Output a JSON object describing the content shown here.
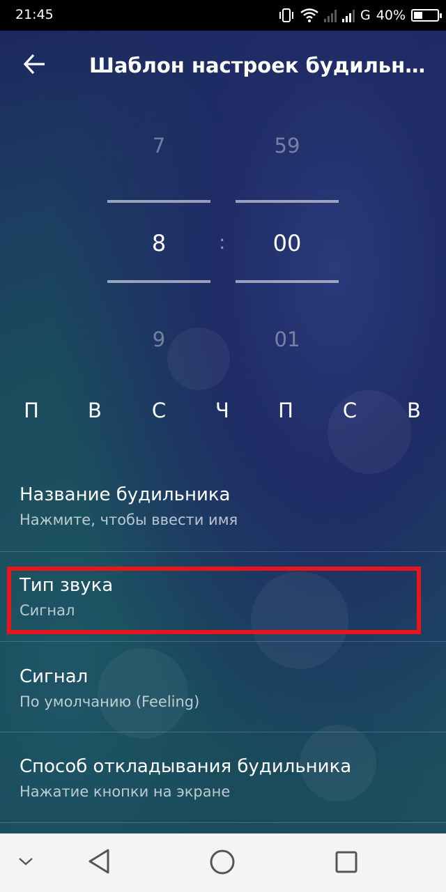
{
  "status_bar": {
    "time": "21:45",
    "network": "G",
    "battery": "40%"
  },
  "app_bar": {
    "title": "Шаблон настроек будильника"
  },
  "time_picker": {
    "hour": {
      "prev": "7",
      "current": "8",
      "next": "9"
    },
    "separator": ":",
    "minute": {
      "prev": "59",
      "current": "00",
      "next": "01"
    }
  },
  "days": [
    "П",
    "В",
    "С",
    "Ч",
    "П",
    "С",
    "В"
  ],
  "settings": [
    {
      "title": "Название будильника",
      "subtitle": "Нажмите, чтобы ввести имя"
    },
    {
      "title": "Тип звука",
      "subtitle": "Сигнал"
    },
    {
      "title": "Сигнал",
      "subtitle": "По умолчанию (Feeling)"
    },
    {
      "title": "Способ откладывания будильника",
      "subtitle": "Нажатие кнопки на экране"
    }
  ],
  "highlight_color": "#e8161b",
  "nav_bar": {
    "icons": [
      "chevron-down-icon",
      "back-triangle-icon",
      "home-circle-icon",
      "recents-square-icon"
    ]
  }
}
